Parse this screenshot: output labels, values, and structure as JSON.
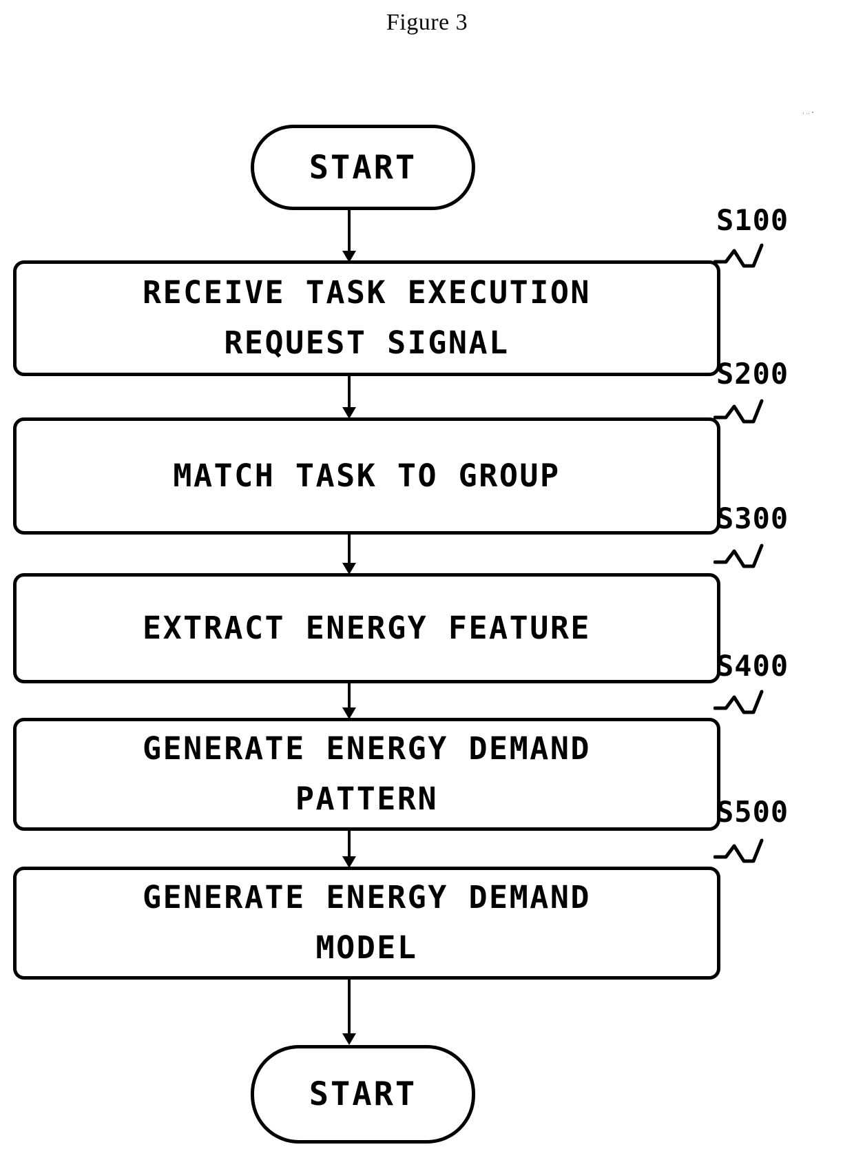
{
  "figure": {
    "title": "Figure 3",
    "type": "flowchart",
    "ink_color": "#000000",
    "background_color": "#ffffff"
  },
  "flow": {
    "start_terminator": {
      "label": "START",
      "shape": "rounded-oval"
    },
    "end_terminator": {
      "label": "START",
      "shape": "rounded-oval"
    },
    "steps": [
      {
        "ref": "S100",
        "label": "RECEIVE TASK EXECUTION\nREQUEST SIGNAL",
        "lines": [
          "RECEIVE TASK EXECUTION",
          "REQUEST SIGNAL"
        ]
      },
      {
        "ref": "S200",
        "label": "MATCH TASK TO GROUP",
        "lines": [
          "MATCH TASK TO GROUP"
        ]
      },
      {
        "ref": "S300",
        "label": "EXTRACT ENERGY FEATURE",
        "lines": [
          "EXTRACT ENERGY FEATURE"
        ]
      },
      {
        "ref": "S400",
        "label": "GENERATE ENERGY DEMAND\nPATTERN",
        "lines": [
          "GENERATE ENERGY DEMAND",
          "PATTERN"
        ]
      },
      {
        "ref": "S500",
        "label": "GENERATE ENERGY DEMAND\nMODEL",
        "lines": [
          "GENERATE ENERGY DEMAND",
          "MODEL"
        ]
      }
    ],
    "connectors": [
      {
        "from": "START",
        "to": "S100",
        "arrow": "down"
      },
      {
        "from": "S100",
        "to": "S200",
        "arrow": "down"
      },
      {
        "from": "S200",
        "to": "S300",
        "arrow": "down"
      },
      {
        "from": "S300",
        "to": "S400",
        "arrow": "down"
      },
      {
        "from": "S400",
        "to": "S500",
        "arrow": "down"
      },
      {
        "from": "S500",
        "to": "START",
        "arrow": "down"
      }
    ]
  }
}
